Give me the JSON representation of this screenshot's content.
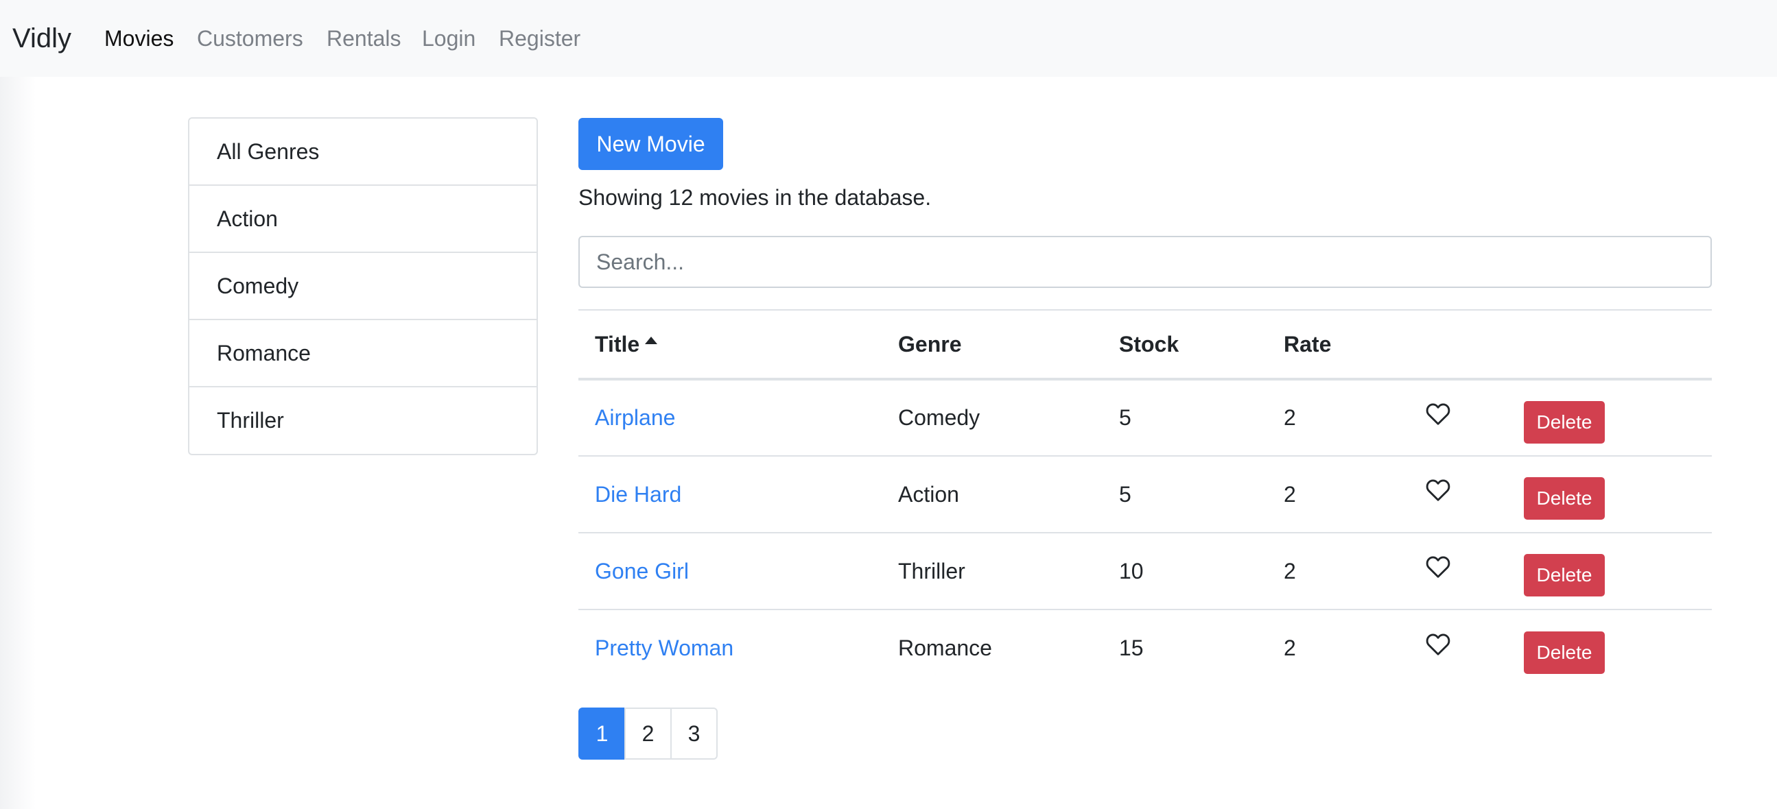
{
  "navbar": {
    "brand": "Vidly",
    "links": [
      {
        "label": "Movies",
        "active": true
      },
      {
        "label": "Customers",
        "active": false
      },
      {
        "label": "Rentals",
        "active": false
      },
      {
        "label": "Login",
        "active": false
      },
      {
        "label": "Register",
        "active": false
      }
    ]
  },
  "genres": [
    "All Genres",
    "Action",
    "Comedy",
    "Romance",
    "Thriller"
  ],
  "main": {
    "new_movie_label": "New Movie",
    "summary": "Showing 12 movies in the database.",
    "search": {
      "placeholder": "Search...",
      "value": ""
    }
  },
  "table": {
    "columns": {
      "title": "Title",
      "genre": "Genre",
      "stock": "Stock",
      "rate": "Rate"
    },
    "sort_icon": "sort-asc-icon",
    "rows": [
      {
        "title": "Airplane",
        "genre": "Comedy",
        "stock": "5",
        "rate": "2",
        "liked": false,
        "delete_label": "Delete"
      },
      {
        "title": "Die Hard",
        "genre": "Action",
        "stock": "5",
        "rate": "2",
        "liked": false,
        "delete_label": "Delete"
      },
      {
        "title": "Gone Girl",
        "genre": "Thriller",
        "stock": "10",
        "rate": "2",
        "liked": false,
        "delete_label": "Delete"
      },
      {
        "title": "Pretty Woman",
        "genre": "Romance",
        "stock": "15",
        "rate": "2",
        "liked": false,
        "delete_label": "Delete"
      }
    ]
  },
  "pagination": {
    "pages": [
      "1",
      "2",
      "3"
    ],
    "current": "1"
  },
  "colors": {
    "primary": "#2f80f2",
    "danger": "#d2404f",
    "navbar_bg": "#f8f9fa"
  }
}
